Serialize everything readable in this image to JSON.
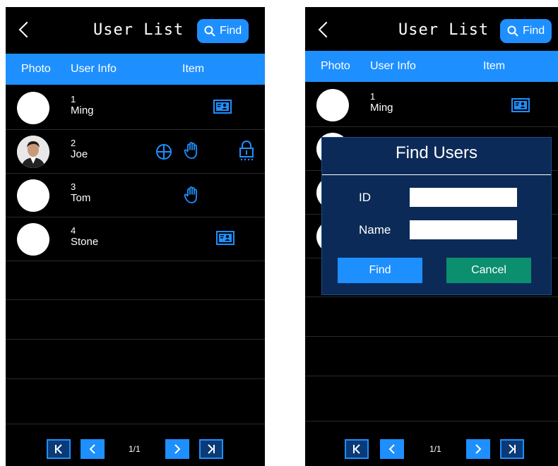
{
  "header": {
    "title": "User List",
    "find_label": "Find"
  },
  "columns": {
    "photo": "Photo",
    "user_info": "User Info",
    "item": "Item"
  },
  "users": [
    {
      "id": "1",
      "name": "Ming"
    },
    {
      "id": "2",
      "name": "Joe"
    },
    {
      "id": "3",
      "name": "Tom"
    },
    {
      "id": "4",
      "name": "Stone"
    }
  ],
  "pagination": {
    "page": "1/1"
  },
  "find_dialog": {
    "title": "Find Users",
    "id_label": "ID",
    "name_label": "Name",
    "id_value": "",
    "name_value": "",
    "find_button": "Find",
    "cancel_button": "Cancel"
  },
  "colors": {
    "accent": "#1e8fff",
    "background": "#000000",
    "dialog": "#0b2a57",
    "cancel": "#0b8f6e"
  }
}
